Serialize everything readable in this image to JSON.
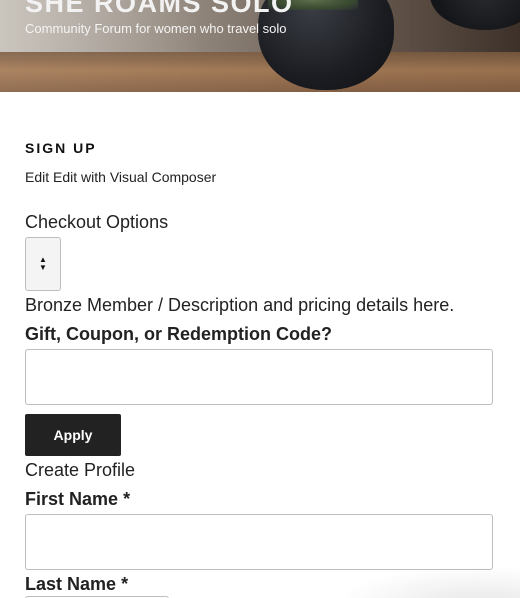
{
  "site": {
    "title": "SHE ROAMS SOLO",
    "description": "Community Forum for women who travel solo"
  },
  "page": {
    "title": "SIGN UP",
    "edit_links": "Edit Edit with Visual Composer"
  },
  "checkout": {
    "heading": "Checkout Options",
    "select_arrows_up": "▲",
    "select_arrows_down": "▼",
    "level_description": "Bronze Member / Description and pricing details here."
  },
  "coupon": {
    "label": "Gift, Coupon, or Redemption Code?",
    "value": "",
    "apply_label": "Apply"
  },
  "profile": {
    "heading": "Create Profile",
    "first_name_label": "First Name",
    "last_name_label": "Last Name",
    "required_marker": "*",
    "first_name_value": ""
  }
}
